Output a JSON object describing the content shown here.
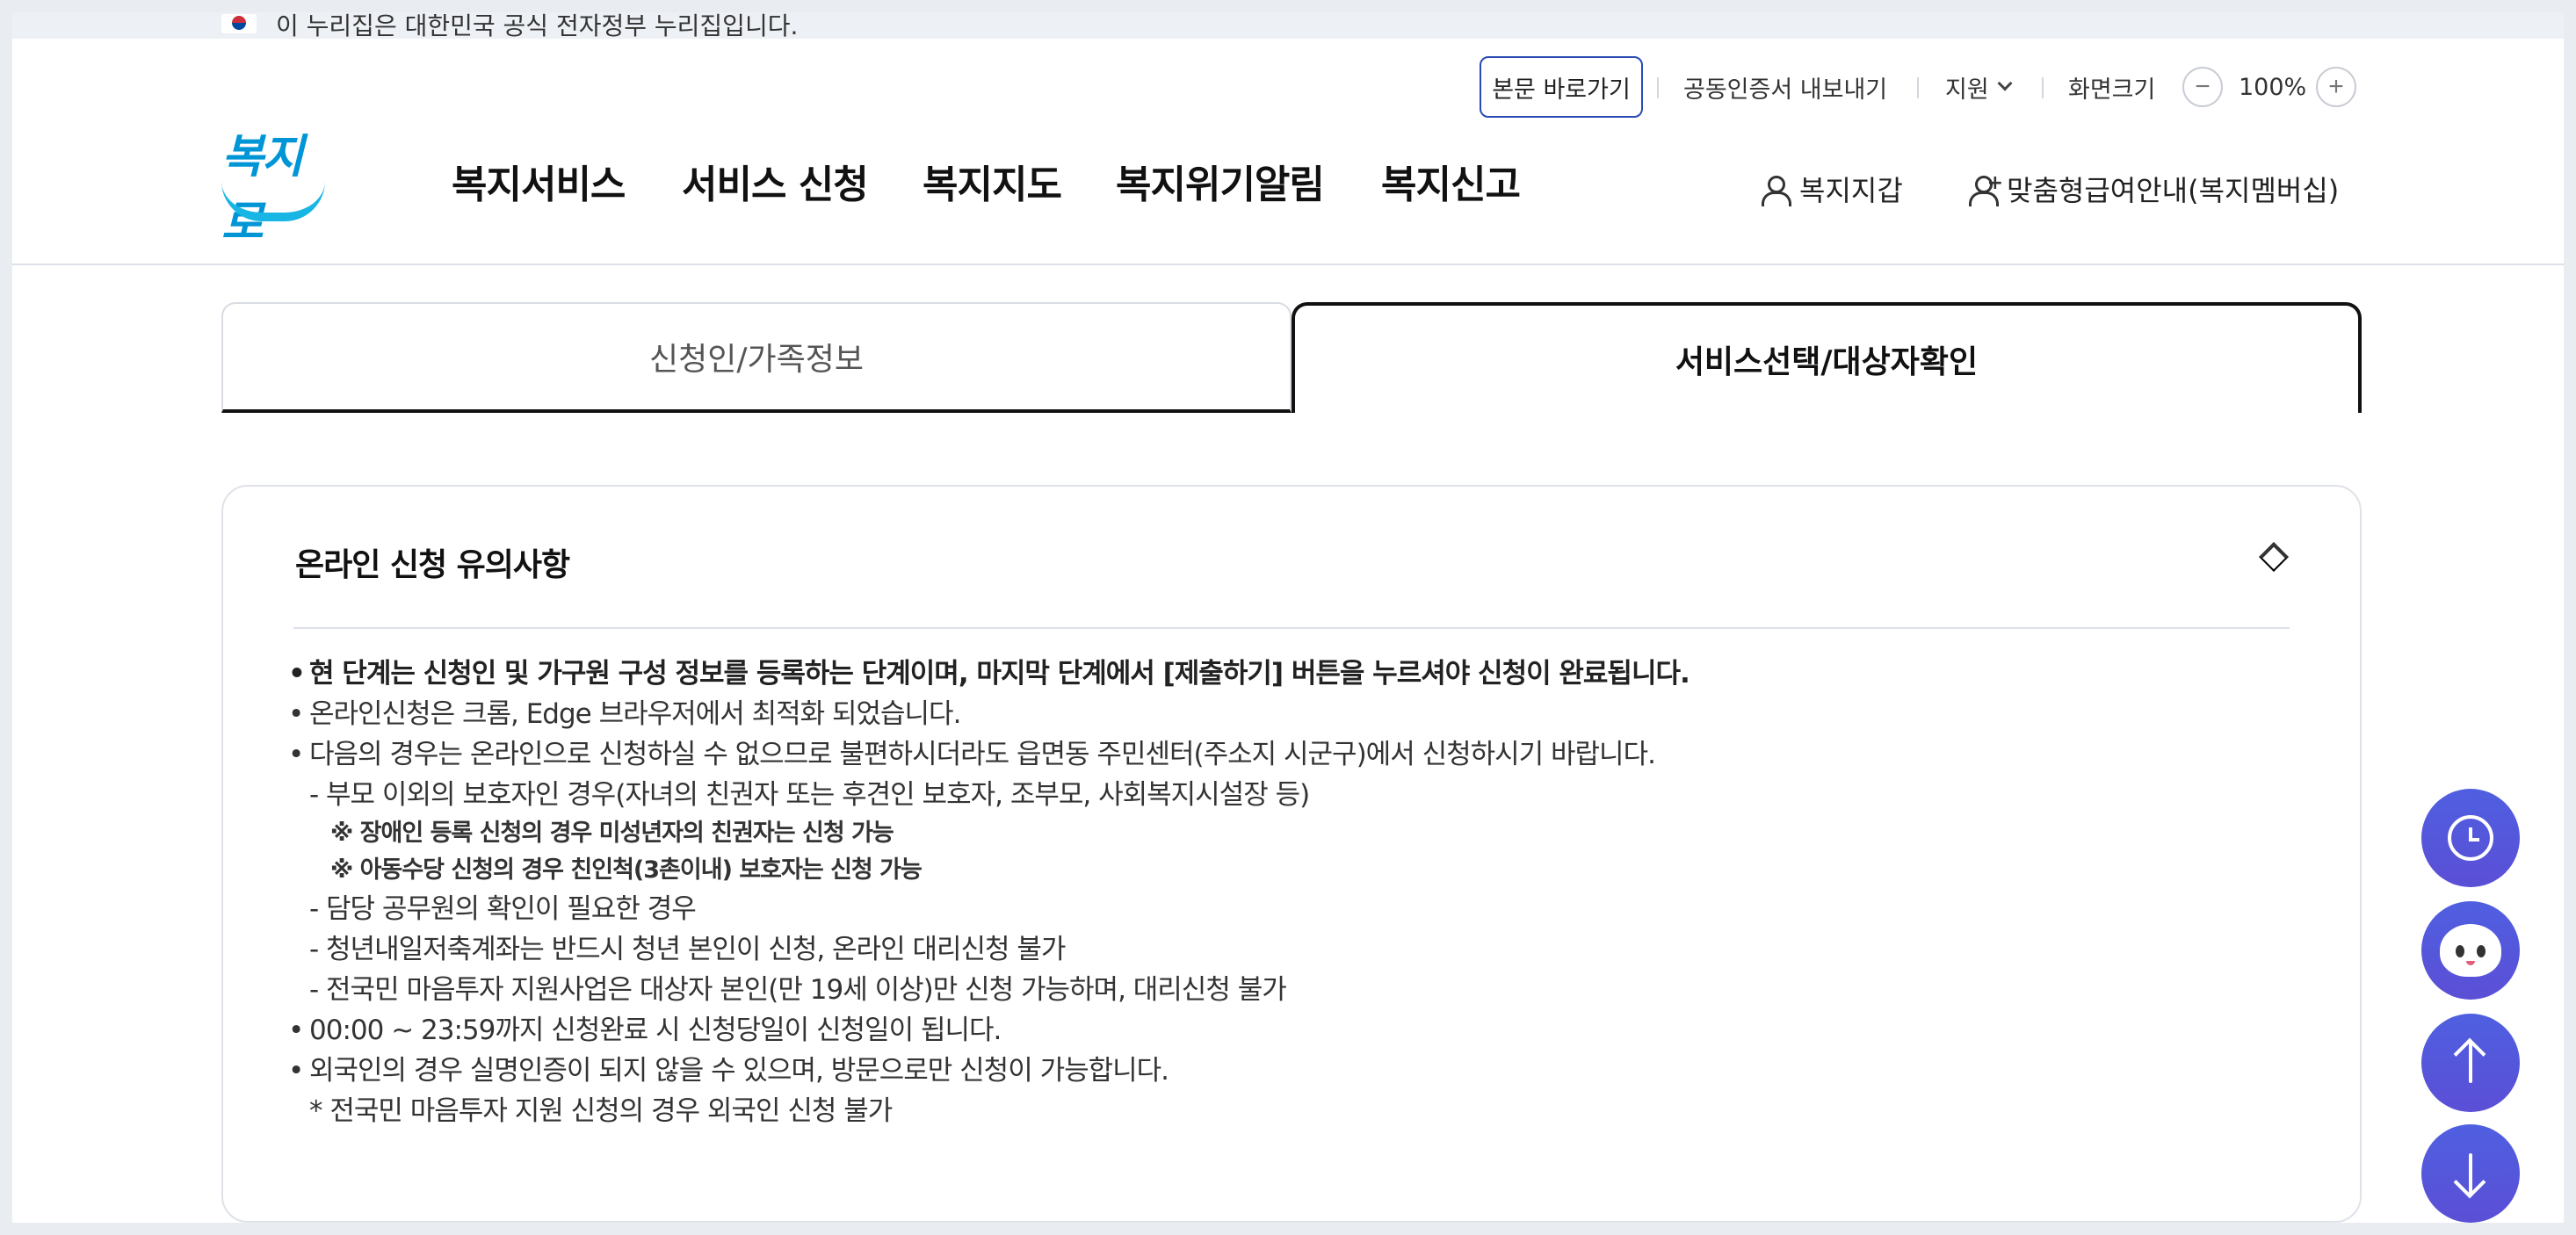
{
  "gov_banner": {
    "text": "이 누리집은 대한민국 공식 전자정부 누리집입니다."
  },
  "utility": {
    "skip_link": "본문 바로가기",
    "cert_export": "공동인증서 내보내기",
    "support": "지원",
    "zoom_label": "화면크기",
    "zoom_value": "100%",
    "zoom_out": "−",
    "zoom_in": "+"
  },
  "logo": {
    "text": "복지로"
  },
  "gnb": {
    "items": [
      "복지서비스",
      "서비스 신청",
      "복지지도",
      "복지위기알림",
      "복지신고"
    ]
  },
  "user_menu": {
    "wallet": "복지지갑",
    "membership": "맞춤형급여안내(복지멤버십)"
  },
  "tabs": [
    {
      "label": "신청인/가족정보",
      "active": false
    },
    {
      "label": "서비스선택/대상자확인",
      "active": true
    }
  ],
  "notice": {
    "title": "온라인 신청 유의사항",
    "lines": [
      "현 단계는 신청인 및 가구원 구성 정보를 등록하는 단계이며, 마지막 단계에서 [제출하기] 버튼을 누르셔야 신청이 완료됩니다.",
      "온라인신청은 크롬, Edge 브라우저에서 최적화 되었습니다.",
      "다음의 경우는 온라인으로 신청하실 수 없으므로 불편하시더라도 읍면동 주민센터(주소지 시군구)에서 신청하시기 바랍니다.",
      "- 부모 이외의 보호자인 경우(자녀의 친권자 또는 후견인 보호자, 조부모, 사회복지시설장 등)",
      "※ 장애인 등록 신청의 경우 미성년자의 친권자는 신청 가능",
      "※ 아동수당 신청의 경우 친인척(3촌이내) 보호자는 신청 가능",
      "- 담당 공무원의 확인이 필요한 경우",
      "- 청년내일저축계좌는 반드시 청년 본인이 신청, 온라인 대리신청 불가",
      "- 전국민 마음투자 지원사업은 대상자 본인(만 19세 이상)만 신청 가능하며, 대리신청 불가",
      "00:00 ~ 23:59까지 신청완료 시 신청당일이 신청일이 됩니다.",
      "외국인의 경우 실명인증이 되지 않을 수 있으며, 방문으로만 신청이 가능합니다.",
      "* 전국민 마음투자 지원 신청의 경우 외국인 신청 불가"
    ]
  },
  "colors": {
    "accent": "#2a4bb3",
    "fab": "#5257dc",
    "logo": "#0096d6"
  }
}
